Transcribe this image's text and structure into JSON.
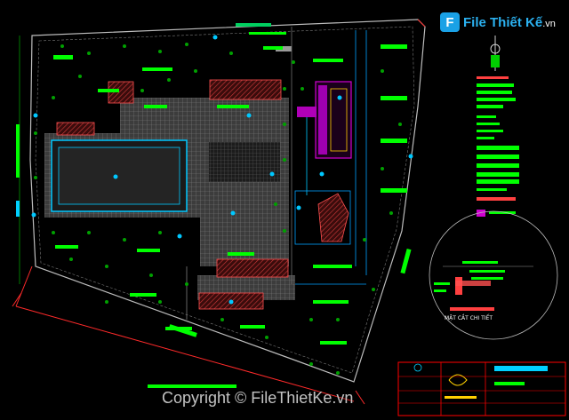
{
  "watermark": {
    "logo_letter": "F",
    "logo_main": "File Thiết Kế",
    "logo_suffix": ".vn",
    "bottom_text": "Copyright © FileThietKe.vn"
  },
  "detail_caption": "MẶT CẮT CHI TIẾT",
  "colors": {
    "background": "#000000",
    "site_boundary": "#c8c8c8",
    "fence_red": "#ff2a2a",
    "label_green": "#00ff00",
    "building_hatch": "#c83232",
    "pool_cyan": "#00c8ff",
    "paving_gray": "#8a8a8a",
    "magenta": "#d000d0",
    "tree_green": "#00a000",
    "title_block": "#ff0000"
  }
}
